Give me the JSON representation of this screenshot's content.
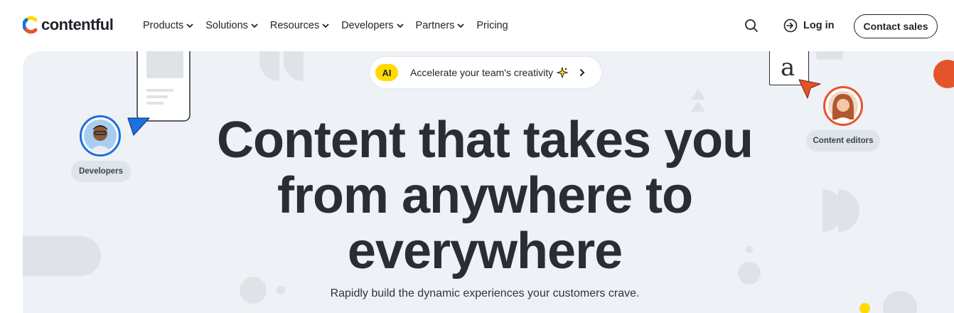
{
  "brand": {
    "name": "contentful"
  },
  "nav": {
    "items": [
      {
        "label": "Products",
        "has_dropdown": true
      },
      {
        "label": "Solutions",
        "has_dropdown": true
      },
      {
        "label": "Resources",
        "has_dropdown": true
      },
      {
        "label": "Developers",
        "has_dropdown": true
      },
      {
        "label": "Partners",
        "has_dropdown": true
      },
      {
        "label": "Pricing",
        "has_dropdown": false
      }
    ],
    "login_label": "Log in",
    "contact_label": "Contact sales"
  },
  "hero": {
    "promo": {
      "badge": "AI",
      "text": "Accelerate your team's creativity"
    },
    "headline_lines": [
      "Content that takes you",
      "from anywhere to",
      "everywhere"
    ],
    "subheadline": "Rapidly build the dynamic experiences your customers crave.",
    "left_persona": {
      "label": "Developers"
    },
    "right_persona": {
      "label": "Content editors"
    },
    "glyph": "a"
  },
  "colors": {
    "hero_bg": "#eef1f5",
    "text": "#1f2329",
    "ai_badge": "#ffda00",
    "cursor_blue": "#1e6fe0",
    "cursor_orange": "#e5532d",
    "logo_blue": "#1e6fe0",
    "logo_yellow": "#ffda00",
    "logo_red": "#e5532d"
  },
  "icons": [
    "logo-icon",
    "chevron-down-icon",
    "search-icon",
    "login-arrow-icon",
    "sparkle-icon",
    "chevron-right-icon",
    "cursor-arrow-icon"
  ]
}
